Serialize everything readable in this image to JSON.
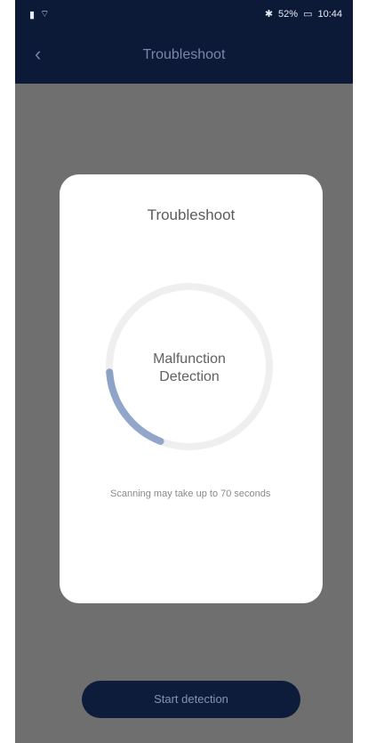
{
  "status_bar": {
    "battery_percent": "52%",
    "time": "10:44",
    "icons": [
      "sim-icon",
      "wifi-icon",
      "bluetooth-icon",
      "battery-icon"
    ]
  },
  "header": {
    "title": "Troubleshoot",
    "back_icon": "back-arrow-icon"
  },
  "dialog": {
    "title": "Troubleshoot",
    "progress_label_line1": "Malfunction",
    "progress_label_line2": "Detection",
    "progress_fraction": 0.18,
    "scan_note": "Scanning may take up to 70 seconds"
  },
  "actions": {
    "start_label": "Start detection"
  },
  "colors": {
    "header_bg": "#0c1a38",
    "overlay": "#6f6f6f",
    "ring_track": "#eeeeee",
    "ring_progress": "#5a79ab",
    "button_bg": "#0d1c3b"
  }
}
